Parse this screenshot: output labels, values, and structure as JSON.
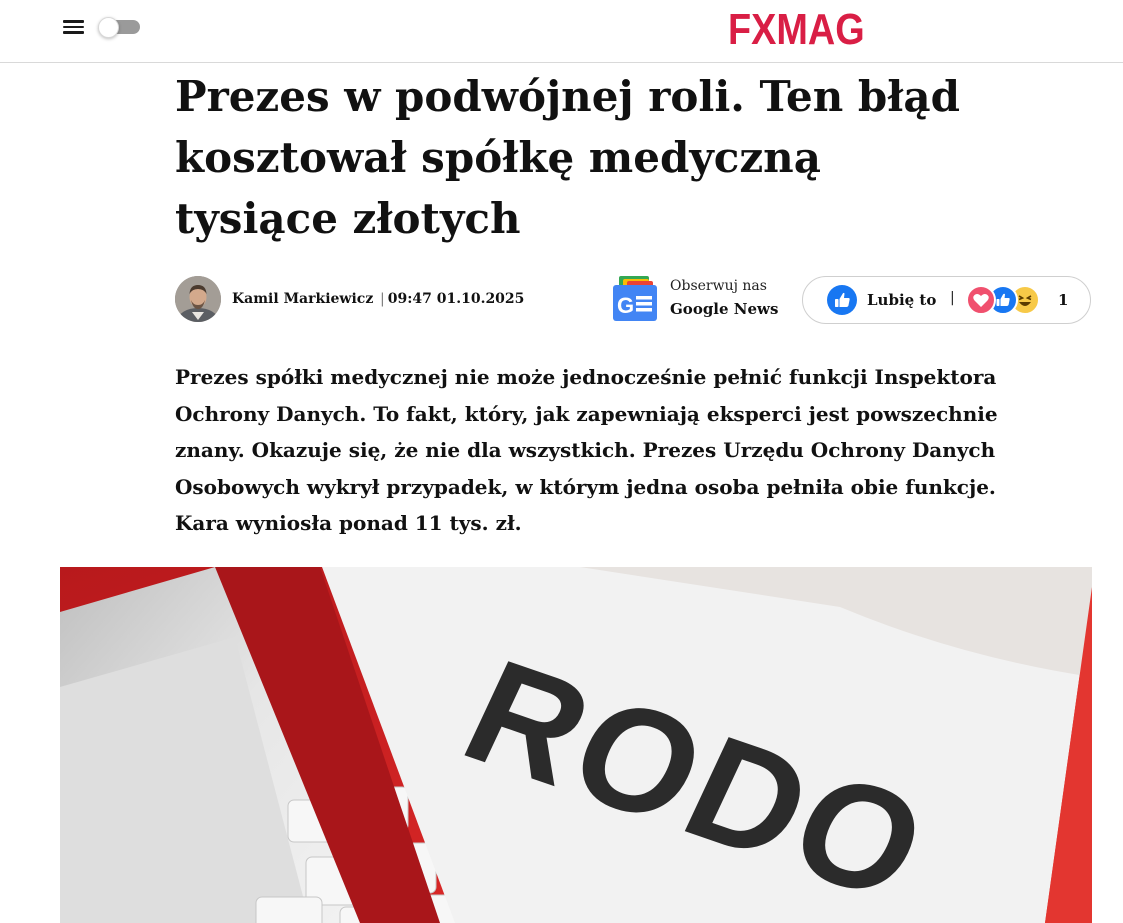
{
  "header": {
    "logo_text": "FXMAG",
    "logo_color": "#d91e45",
    "menu_icon": "hamburger-menu-icon",
    "theme_toggle": "off"
  },
  "article": {
    "title": "Prezes w podwójnej roli. Ten błąd kosztował spółkę medyczną tysiące złotych",
    "author": "Kamil Markiewicz",
    "date_separator": "|",
    "published": "09:47 01.10.2025",
    "lead": "Prezes spółki medycznej nie może jednocześnie pełnić funkcji Inspektora Ochrony Danych. To fakt, który, jak zapewniają eksperci jest powszechnie znany. Okazuje się, że nie dla wszystkich. Prezes Urzędu Ochrony Danych Osobowych wykrył przypadek, w którym jedna osoba pełniła obie funkcje. Kara wyniosła ponad 11 tys. zł.",
    "hero_label": "RODO"
  },
  "google_news": {
    "line1": "Obserwuj nas",
    "line2": "Google News",
    "icon": "google-news-icon"
  },
  "reactions": {
    "like_label": "Lubię to",
    "separator": "|",
    "count": "1",
    "icons": [
      "heart-icon",
      "thumbs-up-icon",
      "laugh-icon"
    ],
    "like_color": "#1877f2"
  }
}
